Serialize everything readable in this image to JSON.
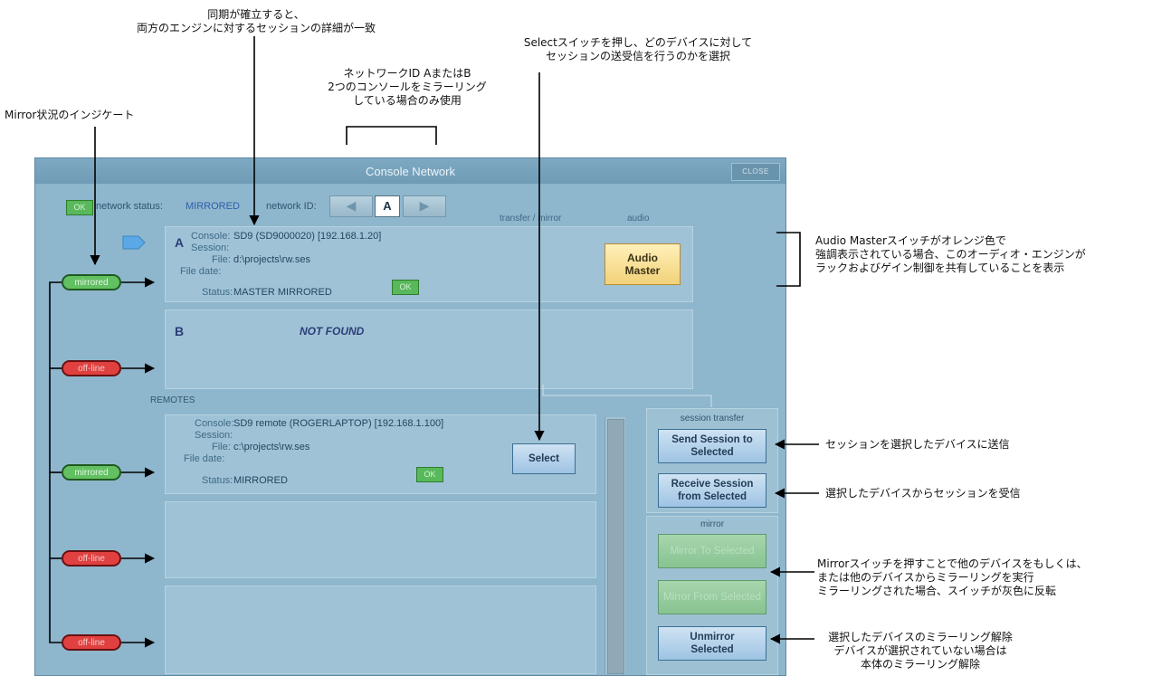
{
  "callouts": {
    "sync": [
      "同期が確立すると、",
      "両方のエンジンに対するセッションの詳細が一致"
    ],
    "select": [
      "Selectスイッチを押し、どのデバイスに対して",
      "セッションの送受信を行うのかを選択"
    ],
    "network_id": [
      "ネットワークID AまたはB",
      "2つのコンソールをミラーリング",
      "している場合のみ使用"
    ],
    "mirror_indicator": "Mirror状況のインジケート",
    "audio_master": [
      "Audio Masterスイッチがオレンジ色で",
      "強調表示されている場合、このオーディオ・エンジンが",
      "ラックおよびゲイン制御を共有していることを表示"
    ],
    "send": "セッションを選択したデバイスに送信",
    "receive": "選択したデバイスからセッションを受信",
    "mirror_buttons": [
      "Mirrorスイッチを押すことで他のデバイスをもしくは、",
      "または他のデバイスからミラーリングを実行",
      "ミラーリングされた場合、スイッチが灰色に反転"
    ],
    "unmirror": [
      "選択したデバイスのミラーリング解除",
      "デバイスが選択されていない場合は",
      "本体のミラーリング解除"
    ]
  },
  "window": {
    "title": "Console Network",
    "close_label": "CLOSE",
    "ok": "OK",
    "network_status_label": "network status:",
    "network_status_value": "MIRRORED",
    "network_id_label": "network ID:",
    "network_id_value": "A",
    "col_transfer_mirror": "transfer / mirror",
    "col_audio": "audio",
    "remotes_label": "REMOTES"
  },
  "field_labels": {
    "console": "Console:",
    "session": "Session:",
    "file": "File:",
    "file_date": "File date:",
    "status": "Status:"
  },
  "engine_a": {
    "letter": "A",
    "console": "SD9 (SD9000020)  [192.168.1.20]",
    "file": "d:\\projects\\rw.ses",
    "status": "MASTER MIRRORED",
    "audio_master": "Audio Master"
  },
  "engine_b": {
    "letter": "B",
    "message": "NOT FOUND"
  },
  "remote_1": {
    "console": "SD9 remote (ROGERLAPTOP)  [192.168.1.100]",
    "file": "c:\\projects\\rw.ses",
    "status": "MIRRORED",
    "select": "Select"
  },
  "side": {
    "session_transfer": "session transfer",
    "send": "Send Session to Selected",
    "receive": "Receive Session from Selected",
    "mirror_hdr": "mirror",
    "mirror_to": "Mirror To Selected",
    "mirror_from": "Mirror From Selected",
    "unmirror": "Unmirror Selected"
  },
  "status_pills": [
    "mirrored",
    "off-line",
    "mirrored",
    "off-line",
    "off-line"
  ]
}
